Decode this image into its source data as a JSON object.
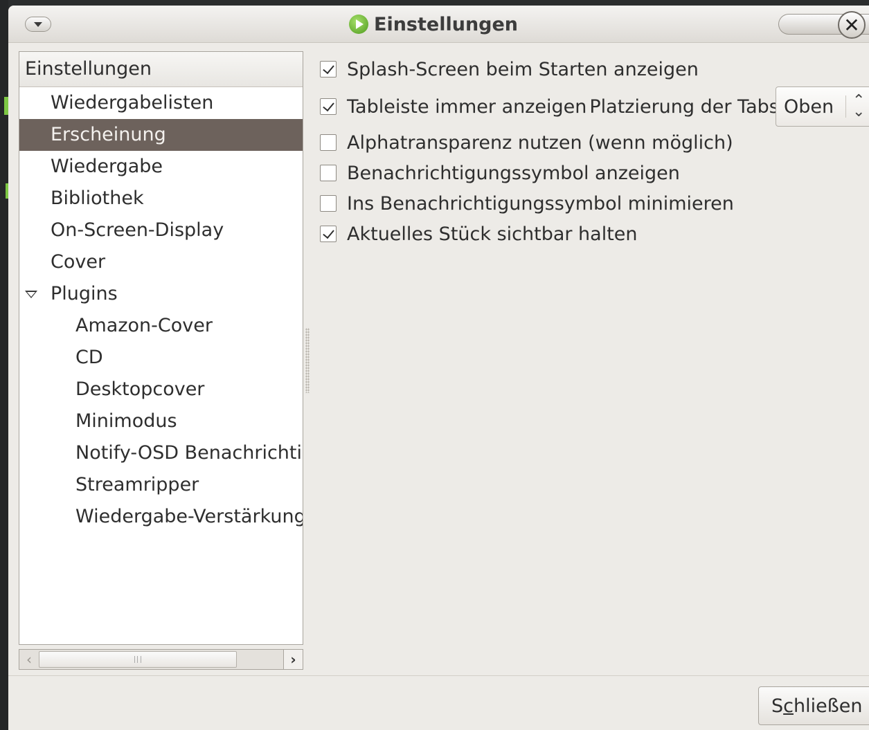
{
  "window": {
    "title": "Einstellungen",
    "close_glyph": "✕"
  },
  "sidebar": {
    "header": "Einstellungen",
    "items": [
      {
        "label": "Wiedergabelisten",
        "level": 1
      },
      {
        "label": "Erscheinung",
        "level": 1,
        "selected": true
      },
      {
        "label": "Wiedergabe",
        "level": 1
      },
      {
        "label": "Bibliothek",
        "level": 1
      },
      {
        "label": "On-Screen-Display",
        "level": 1
      },
      {
        "label": "Cover",
        "level": 1
      },
      {
        "label": "Plugins",
        "level": 1,
        "expanded": true
      },
      {
        "label": "Amazon-Cover",
        "level": 2
      },
      {
        "label": "CD",
        "level": 2
      },
      {
        "label": "Desktopcover",
        "level": 2
      },
      {
        "label": "Minimodus",
        "level": 2
      },
      {
        "label": "Notify-OSD Benachrichtig",
        "level": 2
      },
      {
        "label": "Streamripper",
        "level": 2
      },
      {
        "label": "Wiedergabe-Verstärkung",
        "level": 2
      }
    ]
  },
  "options": [
    {
      "label": "Splash-Screen beim Starten anzeigen",
      "checked": true
    },
    {
      "label": "Tableiste immer anzeigen",
      "checked": true
    },
    {
      "label": "Alphatransparenz nutzen (wenn möglich)",
      "checked": false
    },
    {
      "label": "Benachrichtigungssymbol anzeigen",
      "checked": false
    },
    {
      "label": "Ins Benachrichtigungssymbol minimieren",
      "checked": false
    },
    {
      "label": "Aktuelles Stück sichtbar halten",
      "checked": true
    }
  ],
  "tab_position": {
    "label": "Platzierung der Tabs:",
    "value": "Oben"
  },
  "buttons": {
    "close_pre": "S",
    "close_mnemonic": "c",
    "close_post": "hließen"
  },
  "icons": {
    "menu": "window-menu-icon",
    "app": "exaile-play-icon",
    "close": "close-icon",
    "expander": "expander-down-icon",
    "scroll_left": "‹",
    "scroll_right": "›",
    "combo_arrows": "⌃⌄"
  },
  "colors": {
    "selection_bg": "#6d625c",
    "window_bg": "#edebe7",
    "app_icon_green": "#4e9a1e"
  }
}
